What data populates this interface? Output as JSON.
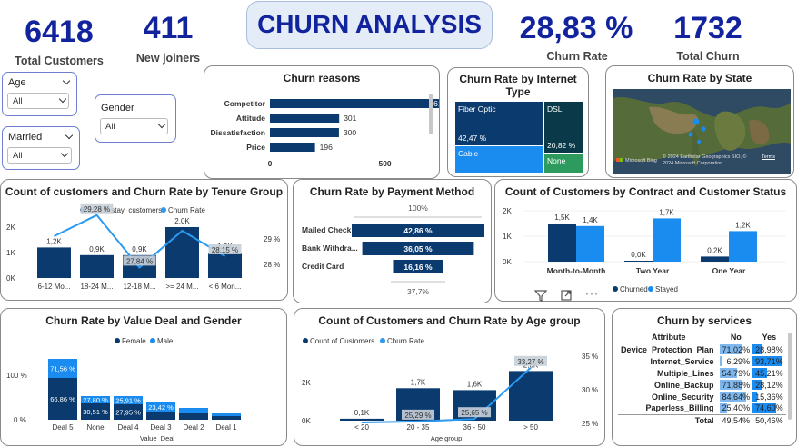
{
  "kpis": {
    "total_customers": {
      "value": "6418",
      "label": "Total Customers"
    },
    "new_joiners": {
      "value": "411",
      "label": "New joiners"
    },
    "title": "CHURN ANALYSIS",
    "churn_rate": {
      "value": "28,83 %",
      "label": "Churn Rate"
    },
    "total_churn": {
      "value": "1732",
      "label": "Total Churn"
    }
  },
  "slicers": {
    "age": {
      "label": "Age",
      "value": "All"
    },
    "gender": {
      "label": "Gender",
      "value": "All"
    },
    "married": {
      "label": "Married",
      "value": "All"
    }
  },
  "colors": {
    "dark": "#0b3a6e",
    "light": "#1a8cf0",
    "line": "#2a9af2",
    "green": "#2e9b5e",
    "kpi": "#12239e"
  },
  "visual_header_icons": [
    "filter-icon",
    "focus-mode-icon",
    "more-options-icon"
  ],
  "churn_by_services": {
    "title": "Churn by services",
    "columns": [
      "Attribute",
      "No",
      "Yes"
    ],
    "rows": [
      {
        "attr": "Device_Protection_Plan",
        "no": "71,02%",
        "yes": "28,98%",
        "no_v": 71.02,
        "yes_v": 28.98
      },
      {
        "attr": "Internet_Service",
        "no": "6,29%",
        "yes": "93,71%",
        "no_v": 6.29,
        "yes_v": 93.71
      },
      {
        "attr": "Multiple_Lines",
        "no": "54,79%",
        "yes": "45,21%",
        "no_v": 54.79,
        "yes_v": 45.21
      },
      {
        "attr": "Online_Backup",
        "no": "71,88%",
        "yes": "28,12%",
        "no_v": 71.88,
        "yes_v": 28.12
      },
      {
        "attr": "Online_Security",
        "no": "84,64%",
        "yes": "15,36%",
        "no_v": 84.64,
        "yes_v": 15.36
      },
      {
        "attr": "Paperless_Billing",
        "no": "25,40%",
        "yes": "74,60%",
        "no_v": 25.4,
        "yes_v": 74.6
      }
    ],
    "total": {
      "attr": "Total",
      "no": "49,54%",
      "yes": "50,46%"
    }
  },
  "chart_data": [
    {
      "id": "churn_reasons",
      "type": "bar",
      "title": "Churn reasons",
      "orientation": "horizontal",
      "categories": [
        "Competitor",
        "Attitude",
        "Dissatisfaction",
        "Price"
      ],
      "values": [
        761,
        301,
        300,
        196
      ],
      "labels": [
        "761",
        "301",
        "300",
        "196"
      ],
      "xlim": [
        0,
        800
      ],
      "xticks": [
        "0",
        "500"
      ]
    },
    {
      "id": "churn_by_internet_type",
      "type": "treemap",
      "title": "Churn Rate by Internet Type",
      "categories": [
        "Fiber Optic",
        "DSL",
        "Cable",
        "None"
      ],
      "values": [
        42.47,
        20.82,
        null,
        null
      ],
      "labels": [
        "42,47 %",
        "20,82 %",
        "",
        ""
      ]
    },
    {
      "id": "churn_by_state",
      "type": "map",
      "title": "Churn Rate by State",
      "attribution": "© 2024 Earthstar Geographics SIO, © 2024 Microsoft Corporation",
      "terms": "Terms",
      "provider": "Microsoft Bing"
    },
    {
      "id": "tenure_group",
      "type": "bar+line",
      "title": "Count of customers and Churn Rate by Tenure Group",
      "legend": [
        "Churn_stay_customers",
        "Churn Rate"
      ],
      "categories": [
        "6-12 Mo...",
        "18-24 M...",
        "12-18 M...",
        ">= 24 M...",
        "< 6 Mon..."
      ],
      "counts": [
        1200,
        900,
        900,
        2000,
        1000
      ],
      "count_labels": [
        "1,2K",
        "0,9K",
        "0,9K",
        "2,0K",
        "1,0K"
      ],
      "churn_rate": [
        null,
        29.28,
        27.84,
        null,
        28.15
      ],
      "rate_labels": [
        "",
        "29,28 %",
        "27,84 %",
        "",
        "28,15 %"
      ],
      "yticks_left": [
        "2K",
        "1K",
        "0K"
      ],
      "yticks_right": [
        "29 %",
        "28 %"
      ]
    },
    {
      "id": "payment_method",
      "type": "funnel",
      "title": "Churn Rate by Payment Method",
      "categories": [
        "Mailed Check",
        "Bank Withdra...",
        "Credit Card"
      ],
      "values": [
        42.86,
        36.05,
        16.16
      ],
      "labels": [
        "42,86 %",
        "36,05 %",
        "16,16 %"
      ],
      "top_label": "100%",
      "bottom_label": "37,7%"
    },
    {
      "id": "contract_status",
      "type": "bar",
      "title": "Count of Customers by Contract and Customer Status",
      "categories": [
        "Month-to-Month",
        "Two Year",
        "One Year"
      ],
      "series": [
        {
          "name": "Churned",
          "values": [
            1500,
            0,
            200
          ],
          "labels": [
            "1,5K",
            "0,0K",
            "0,2K"
          ]
        },
        {
          "name": "Stayed",
          "values": [
            1400,
            1700,
            1200
          ],
          "labels": [
            "1,4K",
            "1,7K",
            "1,2K"
          ]
        }
      ],
      "yticks": [
        "2K",
        "1K",
        "0K"
      ]
    },
    {
      "id": "value_deal_gender",
      "type": "stacked_bar",
      "title": "Churn Rate by Value Deal and Gender",
      "xlabel": "Value_Deal",
      "legend": [
        "Female",
        "Male"
      ],
      "categories": [
        "Deal 5",
        "None",
        "Deal 4",
        "Deal 3",
        "Deal 2",
        "Deal 1"
      ],
      "series": [
        {
          "name": "Female",
          "values": [
            66.86,
            30.51,
            27.95,
            null,
            null,
            null
          ],
          "labels": [
            "66,86 %",
            "30,51 %",
            "27,95 %",
            "",
            "",
            ""
          ]
        },
        {
          "name": "Male",
          "values": [
            71.56,
            27.8,
            25.91,
            23.42,
            null,
            null
          ],
          "labels": [
            "71,56 %",
            "27,80 %",
            "25,91 %",
            "23,42 %",
            "",
            ""
          ]
        }
      ],
      "yticks": [
        "100 %",
        "0 %"
      ]
    },
    {
      "id": "age_group",
      "type": "bar+line",
      "title": "Count of Customers and Churn Rate by Age group",
      "xlabel": "Age group",
      "legend": [
        "Count of Customers",
        "Churn Rate"
      ],
      "categories": [
        "< 20",
        "20 - 35",
        "36 - 50",
        "> 50"
      ],
      "counts": [
        100,
        1700,
        1600,
        2600
      ],
      "count_labels": [
        "0,1K",
        "1,7K",
        "1,6K",
        "2,6K"
      ],
      "churn_rate": [
        null,
        25.29,
        25.65,
        33.27
      ],
      "rate_labels": [
        "",
        "25,29 %",
        "25,65 %",
        "33,27 %"
      ],
      "yticks_left": [
        "2K",
        "0K"
      ],
      "yticks_right": [
        "35 %",
        "30 %",
        "25 %"
      ]
    }
  ]
}
